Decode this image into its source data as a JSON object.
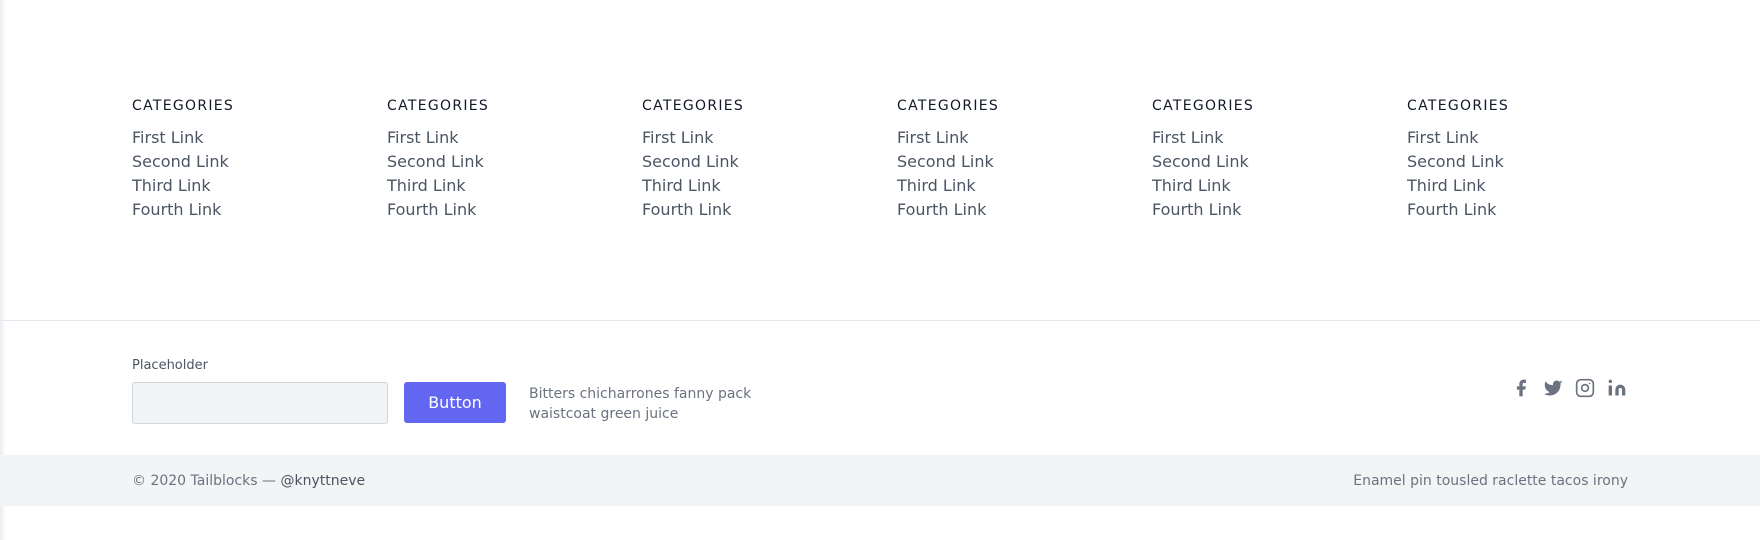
{
  "categories": [
    {
      "heading": "CATEGORIES",
      "links": [
        "First Link",
        "Second Link",
        "Third Link",
        "Fourth Link"
      ]
    },
    {
      "heading": "CATEGORIES",
      "links": [
        "First Link",
        "Second Link",
        "Third Link",
        "Fourth Link"
      ]
    },
    {
      "heading": "CATEGORIES",
      "links": [
        "First Link",
        "Second Link",
        "Third Link",
        "Fourth Link"
      ]
    },
    {
      "heading": "CATEGORIES",
      "links": [
        "First Link",
        "Second Link",
        "Third Link",
        "Fourth Link"
      ]
    },
    {
      "heading": "CATEGORIES",
      "links": [
        "First Link",
        "Second Link",
        "Third Link",
        "Fourth Link"
      ]
    },
    {
      "heading": "CATEGORIES",
      "links": [
        "First Link",
        "Second Link",
        "Third Link",
        "Fourth Link"
      ]
    }
  ],
  "subscribe": {
    "label": "Placeholder",
    "input_value": "",
    "button_label": "Button",
    "note": "Bitters chicharrones fanny pack waistcoat green juice"
  },
  "social_icons": [
    "facebook-icon",
    "twitter-icon",
    "instagram-icon",
    "linkedin-icon"
  ],
  "footer": {
    "copyright": "© 2020 Tailblocks — ",
    "handle": "@knyttneve",
    "tagline": "Enamel pin tousled raclette tacos irony"
  },
  "colors": {
    "accent": "#6366f1",
    "text": "#4b5563",
    "heading": "#111827",
    "muted": "#6b7280",
    "bar_bg": "#f3f4f6"
  }
}
